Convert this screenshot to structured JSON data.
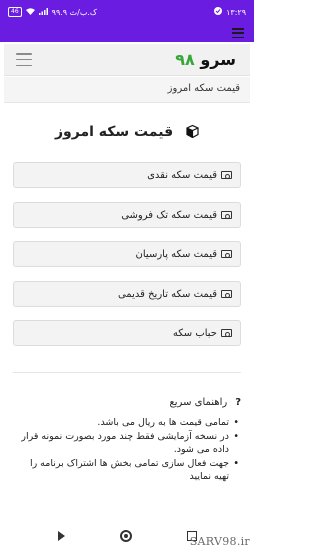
{
  "status_bar": {
    "time": "۱۳:۲۹",
    "network_speed": "۹۹.۹ ک.ب/ث",
    "battery": "46"
  },
  "header": {
    "logo_text": "سرو",
    "logo_number": "۹۸"
  },
  "breadcrumb": "قیمت سکه امروز",
  "page_title": "قیمت سکه امروز",
  "buttons": [
    {
      "label": "قیمت سکه نقدی"
    },
    {
      "label": "قیمت سکه تک فروشی"
    },
    {
      "label": "قیمت سکه پارسیان"
    },
    {
      "label": "قیمت سکه تاریخ قدیمی"
    },
    {
      "label": "حباب سکه"
    }
  ],
  "guide": {
    "title": "راهنمای سریع",
    "items": [
      "تمامی قیمت ها به ریال می باشد.",
      "در نسخه آزمایشی فقط چند مورد بصورت نمونه قرار داده می شود.",
      "",
      "جهت فعال سازی تمامی بخش ها اشتراک برنامه را تهیه نمایید"
    ]
  },
  "watermark": "SARV98.ir"
}
